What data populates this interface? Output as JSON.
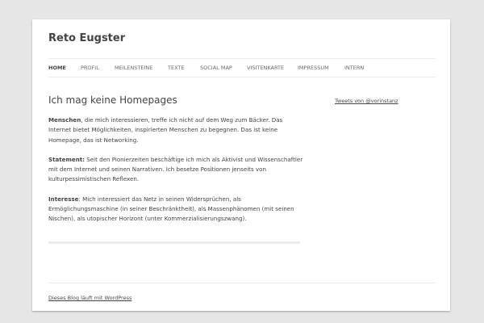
{
  "site": {
    "title": "Reto Eugster"
  },
  "nav": {
    "items": [
      {
        "label": "HOME",
        "active": true
      },
      {
        "label": "PROFIL"
      },
      {
        "label": "MEILENSTEINE"
      },
      {
        "label": "TEXTE"
      },
      {
        "label": "SOCIAL MAP"
      },
      {
        "label": "VISITENKARTE"
      },
      {
        "label": "IMPRESSUM"
      },
      {
        "label": "INTERN"
      }
    ]
  },
  "main": {
    "title": "Ich mag keine Homepages",
    "paragraphs": [
      {
        "lead": "Menschen",
        "text": ", die mich interessieren, treffe ich nicht auf dem Weg zum Bäcker. Das Internet bietet Möglichkeiten, inspirierten Menschen zu begegnen. Das ist keine Homepage, das ist Networking."
      },
      {
        "lead": "Statement:",
        "text": " Seit den Pionierzeiten beschäftige ich mich als Aktivist und Wissenschaftler mit dem Internet und seinen Narrativen. Ich besetze Positionen jenseits von kulturpessimistischen Reflexen."
      },
      {
        "lead": "Interesse",
        "text": ": Mich interessiert das Netz in seinen Widersprüchen, als Ermöglichungsmaschine (in seiner Beschränktheit), als Massenphänomen (mit seinen Nischen), als utopischer Horizont (unter Kommerzialisierungszwang)."
      }
    ]
  },
  "sidebar": {
    "tweets_link": "Tweets von @vorinstanz"
  },
  "footer": {
    "credit": "Dieses Blog läuft mit WordPress"
  },
  "colors": {
    "background": "#e6e6e6",
    "page": "#ffffff",
    "text": "#444444",
    "nav_text": "#6a6a6a",
    "rule": "#ededed"
  }
}
